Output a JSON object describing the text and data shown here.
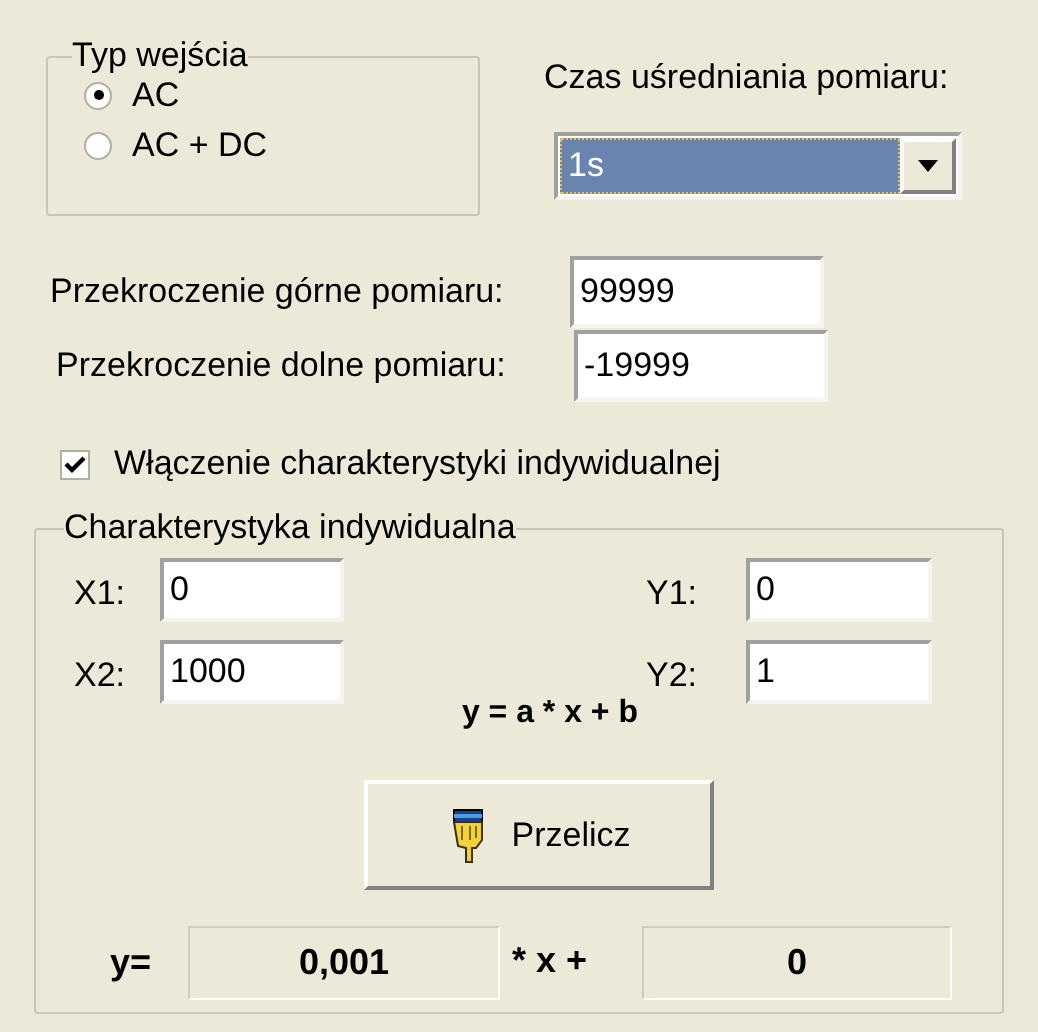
{
  "input_type": {
    "title": "Typ wejścia",
    "options": [
      {
        "label": "AC",
        "selected": true
      },
      {
        "label": "AC + DC",
        "selected": false
      }
    ]
  },
  "averaging_time": {
    "label": "Czas uśredniania pomiaru:",
    "value": "1s"
  },
  "limits": [
    {
      "label": "Przekroczenie górne pomiaru:",
      "value": "99999"
    },
    {
      "label": "Przekroczenie dolne pomiaru:",
      "value": "-19999"
    }
  ],
  "enable_individual": {
    "label": "Włączenie charakterystyki indywidualnej",
    "checked": true
  },
  "individual": {
    "title": "Charakterystyka indywidualna",
    "x_points": [
      {
        "label": "X1:",
        "value": "0"
      },
      {
        "label": "X2:",
        "value": "1000"
      }
    ],
    "y_points": [
      {
        "label": "Y1:",
        "value": "0"
      },
      {
        "label": "Y2:",
        "value": "1"
      }
    ],
    "formula": "y = a * x + b",
    "button": "Przelicz",
    "result": {
      "y_label": "y=",
      "a": "0,001",
      "mid_label": "* x +",
      "b": "0"
    }
  }
}
